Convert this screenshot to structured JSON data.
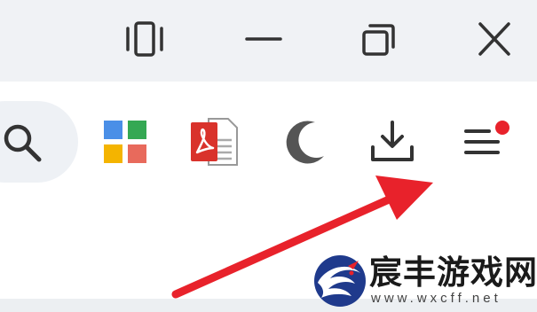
{
  "window_controls": {
    "tablet_mode": "tablet-mode-icon",
    "minimize": "minimize-icon",
    "restore": "restore-icon",
    "close": "close-icon"
  },
  "toolbar": {
    "search": "search-icon",
    "apps": "apps-grid-icon",
    "pdf": "pdf-tool-icon",
    "dark_mode": "moon-icon",
    "download": "download-icon",
    "menu": "menu-icon",
    "menu_has_notification": true
  },
  "colors": {
    "titlebar_bg": "#f0f2f5",
    "icon_dark": "#333333",
    "apps_blue": "#4a8fe7",
    "apps_green": "#34a853",
    "apps_yellow": "#f4b400",
    "apps_red": "#e86a5c",
    "pdf_red": "#d9322b",
    "notification_dot": "#e8222b",
    "arrow_red": "#e8222b"
  },
  "watermark": {
    "title": "宸丰游戏网",
    "url": "www.wxcff.net"
  }
}
